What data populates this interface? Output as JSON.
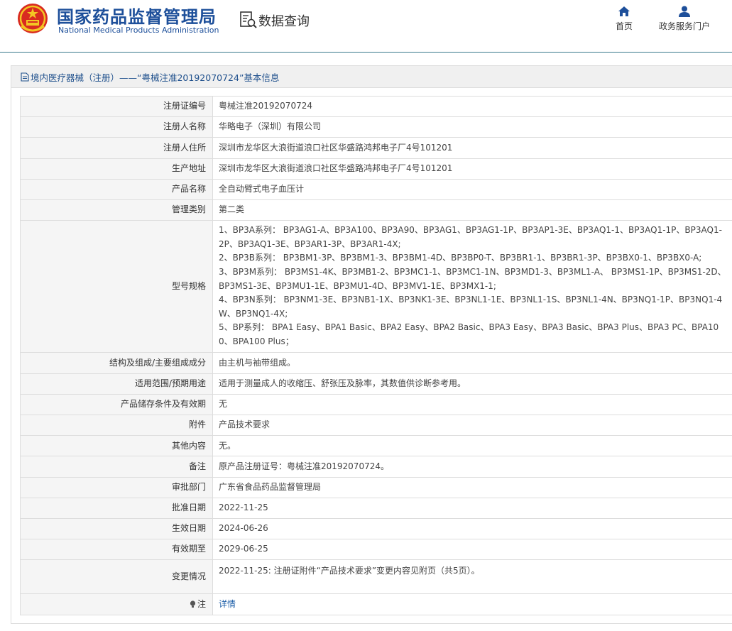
{
  "header": {
    "logo_cn": "国家药品监督管理局",
    "logo_en": "National Medical Products Administration",
    "query_title": "数据查询",
    "nav": [
      {
        "label": "首页",
        "icon": "home-icon"
      },
      {
        "label": "政务服务门户",
        "icon": "user-icon"
      }
    ]
  },
  "panel": {
    "title": "境内医疗器械（注册）——“粤械注准20192070724”基本信息"
  },
  "rows": [
    {
      "key": "注册证编号",
      "value": "粤械注准20192070724"
    },
    {
      "key": "注册人名称",
      "value": "华略电子（深圳）有限公司"
    },
    {
      "key": "注册人住所",
      "value": "深圳市龙华区大浪街道浪口社区华盛路鸿邦电子厂4号101201"
    },
    {
      "key": "生产地址",
      "value": "深圳市龙华区大浪街道浪口社区华盛路鸿邦电子厂4号101201"
    },
    {
      "key": "产品名称",
      "value": "全自动臂式电子血压计"
    },
    {
      "key": "管理类别",
      "value": "第二类"
    },
    {
      "key": "型号规格",
      "lines": [
        "1、BP3A系列： BP3AG1-A、BP3A100、BP3A90、BP3AG1、BP3AG1-1P、BP3AP1-3E、BP3AQ1-1、BP3AQ1-1P、BP3AQ1-2P、BP3AQ1-3E、BP3AR1-3P、BP3AR1-4X;",
        "2、BP3B系列： BP3BM1-3P、BP3BM1-3、BP3BM1-4D、BP3BP0-T、BP3BR1-1、BP3BR1-3P、BP3BX0-1、BP3BX0-A;",
        "3、BP3M系列： BP3MS1-4K、BP3MB1-2、BP3MC1-1、BP3MC1-1N、BP3MD1-3、BP3ML1-A、 BP3MS1-1P、BP3MS1-2D、BP3MS1-3E、BP3MU1-1E、BP3MU1-4D、BP3MV1-1E、BP3MX1-1;",
        "4、BP3N系列： BP3NM1-3E、BP3NB1-1X、BP3NK1-3E、BP3NL1-1E、BP3NL1-1S、BP3NL1-4N、BP3NQ1-1P、BP3NQ1-4W、BP3NQ1-4X;",
        "5、BP系列： BPA1 Easy、BPA1 Basic、BPA2 Easy、BPA2 Basic、BPA3 Easy、BPA3 Basic、BPA3 Plus、BPA3 PC、BPA100、BPA100 Plus；"
      ]
    },
    {
      "key": "结构及组成/主要组成成分",
      "value": "由主机与袖带组成。"
    },
    {
      "key": "适用范围/预期用途",
      "value": "适用于测量成人的收缩压、舒张压及脉率，其数值供诊断参考用。"
    },
    {
      "key": "产品储存条件及有效期",
      "value": "无"
    },
    {
      "key": "附件",
      "value": "产品技术要求"
    },
    {
      "key": "其他内容",
      "value": "无。"
    },
    {
      "key": "备注",
      "value": "原产品注册证号：粤械注准20192070724。"
    },
    {
      "key": "审批部门",
      "value": "广东省食品药品监督管理局"
    },
    {
      "key": "批准日期",
      "value": "2022-11-25"
    },
    {
      "key": "生效日期",
      "value": "2024-06-26"
    },
    {
      "key": "有效期至",
      "value": "2029-06-25"
    },
    {
      "key": "变更情况",
      "value": "2022-11-25: 注册证附件“产品技术要求”变更内容见附页（共5页）。"
    },
    {
      "key": "注",
      "value": "详情"
    }
  ]
}
